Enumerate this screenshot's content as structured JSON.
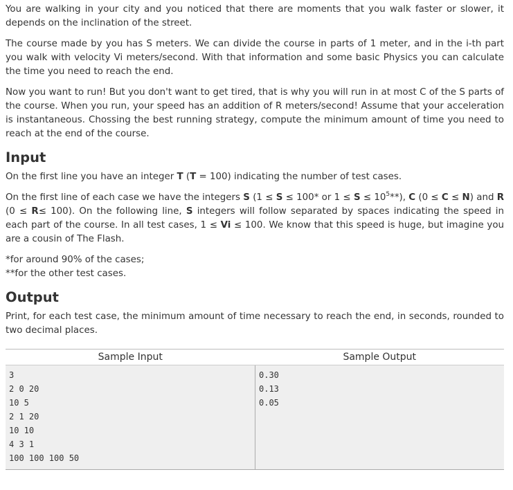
{
  "statement": {
    "p1": "You are walking in your city and you noticed that there are moments that you walk faster or slower, it depends on the inclination of the street.",
    "p2": "The course made by you has S meters. We can divide the course in parts of 1 meter, and in the i-th part you walk with velocity Vi meters/second. With that information and some basic Physics you can calculate the time you need to reach the end.",
    "p3": "Now you want to run! But you don't want to get tired, that is why you will run in at most C of the S parts of the course. When you run, your speed has an addition of R meters/second! Assume that your acceleration is instantaneous. Chossing the best running strategy, compute the minimum amount of time you need to reach at the end of the course."
  },
  "input": {
    "heading": "Input",
    "p1": {
      "a": "On the first line you have an integer ",
      "T1": "T",
      "b": " (",
      "T2": "T",
      "c": " = 100) indicating the number of test cases."
    },
    "p2": {
      "a": "On the first line of each case we have the integers ",
      "S1": "S",
      "b": " (1 ≤ ",
      "S2": "S",
      "c": " ≤ 100* or 1 ≤ ",
      "S3": "S",
      "d": " ≤ 10",
      "sup": "5",
      "e": "**), ",
      "C1": "C",
      "f": " (0 ≤ ",
      "C2": "C",
      "g": " ≤ ",
      "N": "N",
      "h": ") and ",
      "R1": "R",
      "i": " (0 ≤ ",
      "R2": "R",
      "j": "≤ 100). On the following line, ",
      "S4": "S",
      "k": " integers will follow separated by spaces indicating the speed in each part of the course. In all test cases, 1 ≤ ",
      "Vi": "Vi",
      "l": " ≤ 100. We know that this speed is huge, but imagine you are a cousin of The Flash."
    },
    "foot1": "*for around 90% of the cases;",
    "foot2": "**for the other test cases."
  },
  "output": {
    "heading": "Output",
    "p1": "Print, for each test case, the minimum amount of time necessary to reach the end, in seconds, rounded to two decimal places."
  },
  "samples": {
    "input_header": "Sample Input",
    "output_header": "Sample Output",
    "input_lines": [
      "3",
      "2 0 20",
      "10 5",
      "2 1 20",
      "10 10",
      "4 3 1",
      "100 100 100 50"
    ],
    "output_lines": [
      "0.30",
      "0.13",
      "0.05"
    ]
  }
}
